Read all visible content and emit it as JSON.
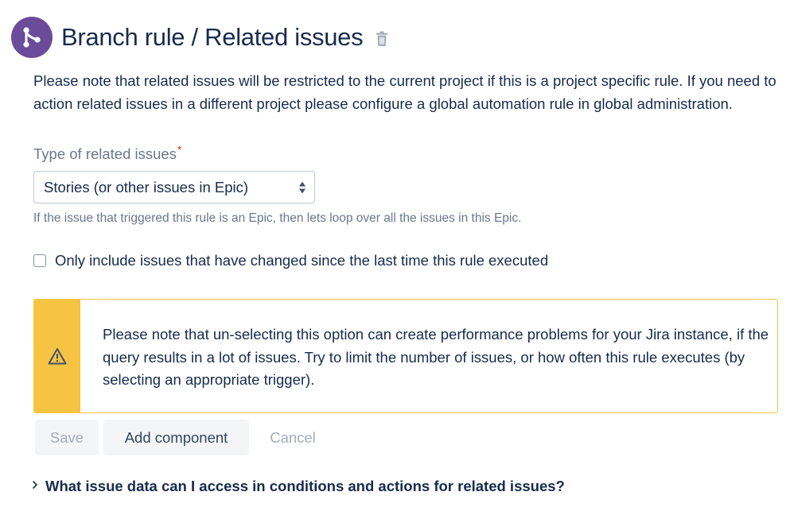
{
  "header": {
    "title": "Branch rule / Related issues",
    "avatar_icon": "branch-icon",
    "avatar_color": "#6b4c9a",
    "delete_icon": "trash-icon"
  },
  "note": "Please note that related issues will be restricted to the current project if this is a project specific rule. If you need to action related issues in a different project please configure a global automation rule in global administration.",
  "related_issues_field": {
    "label": "Type of related issues",
    "required_marker": "*",
    "selected_value": "Stories (or other issues in Epic)",
    "helper_text": "If the issue that triggered this rule is an Epic, then lets loop over all the issues in this Epic."
  },
  "changed_only_checkbox": {
    "label": "Only include issues that have changed since the last time this rule executed",
    "checked": false
  },
  "warning": {
    "icon": "warning-icon",
    "accent_color": "#f6c342",
    "text": "Please note that un-selecting this option can create performance problems for your Jira instance, if the query results in a lot of issues. Try to limit the number of issues, or how often this rule executes (by selecting an appropriate trigger)."
  },
  "actions": {
    "save_label": "Save",
    "add_component_label": "Add component",
    "cancel_label": "Cancel"
  },
  "faq": {
    "icon": "chevron-right-icon",
    "label": "What issue data can I access in conditions and actions for related issues?"
  }
}
